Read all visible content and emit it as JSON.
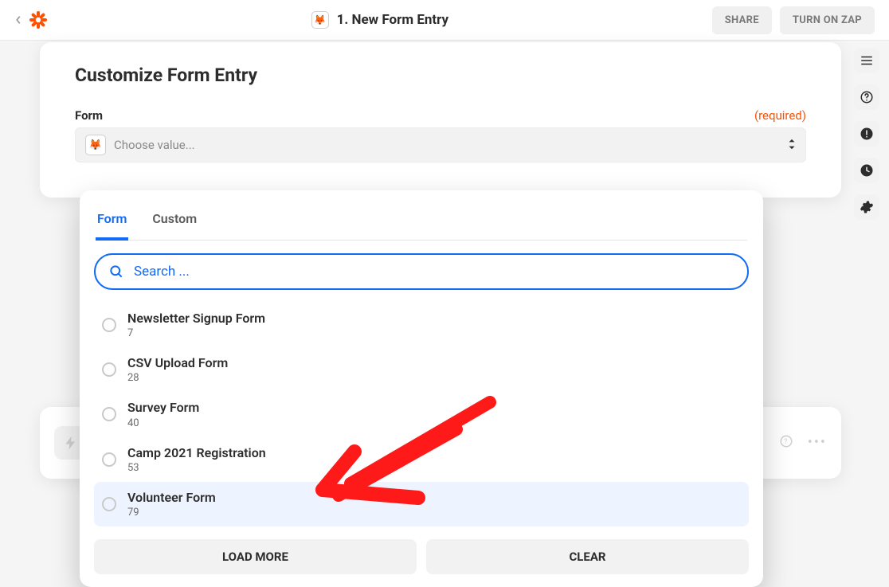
{
  "header": {
    "step_title": "1. New Form Entry",
    "share_label": "SHARE",
    "turn_on_label": "TURN ON ZAP"
  },
  "card": {
    "title": "Customize Form Entry",
    "field_label": "Form",
    "required_label": "(required)",
    "select_placeholder": "Choose value..."
  },
  "popover": {
    "tabs": {
      "form": "Form",
      "custom": "Custom"
    },
    "search_placeholder": "Search ...",
    "options": [
      {
        "name": "Newsletter Signup Form",
        "id": "7"
      },
      {
        "name": "CSV Upload Form",
        "id": "28"
      },
      {
        "name": "Survey Form",
        "id": "40"
      },
      {
        "name": "Camp 2021 Registration",
        "id": "53"
      },
      {
        "name": "Volunteer Form",
        "id": "79"
      }
    ],
    "load_more_label": "LOAD MORE",
    "clear_label": "CLEAR"
  },
  "icons": {
    "app_emoji": "🦊"
  }
}
